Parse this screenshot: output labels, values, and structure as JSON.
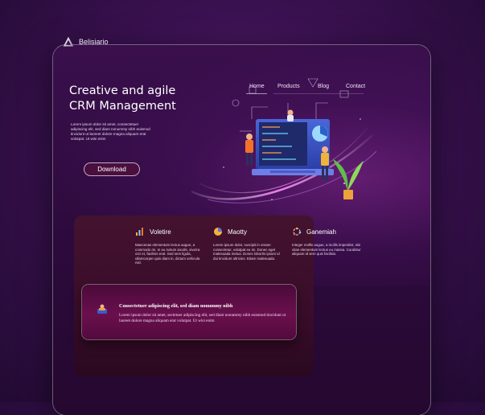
{
  "brand": {
    "name": "Belisiario"
  },
  "nav": [
    {
      "label": "Home",
      "active": true
    },
    {
      "label": "Products",
      "active": false
    },
    {
      "label": "Blog",
      "active": false
    },
    {
      "label": "Contact",
      "active": false
    }
  ],
  "hero": {
    "title_line1": "Creative and agile",
    "title_line2": "CRM Management",
    "body": "Lorem ipsum dolor sit amet, consectetuer adipiscing elit, sed diam nonummy nibh euismod tincidunt ut laoreet dolore magna aliquam erat volutpat. Ut wisi enim",
    "cta_label": "Download"
  },
  "features": [
    {
      "title": "Voletire",
      "icon": "bar-chart-icon",
      "text": "Maecenas elementum lectus augue, a commodo mi. In eu rutrum iaculis, viverra orci et, facilisis erat. Sed sem ligula, ullamcorper quis diam in, dictum vehicula nisl."
    },
    {
      "title": "Maotty",
      "icon": "pie-chart-icon",
      "text": "Lorem ipsum dolor, suscipit in ornare consectetur, volutpat eu mi. Donec eget malesuada metus. Donec lobortis ipsum id dui tincidunt ultricies. Etiam malesuada."
    },
    {
      "title": "Ganemiah",
      "icon": "cycle-icon",
      "text": "Integer mollis augue, a mollis imperdiet, nisi vitae elementum lectus eu massa. Curabitur aliquam id sem quis facilisis."
    }
  ],
  "callout": {
    "icon": "presentation-icon",
    "title": "Consectetuer adipiscing elit, sed diam nonummy nibh",
    "text": "Lorem ipsum dolor sit amet, sectetuer adipiscing elit, sed diam nonummy nibh euismod tincidunt ut laoreet dolore magna aliquam erat volutpat. Ut wisi enim"
  },
  "colors": {
    "accent": "#c03fd0",
    "background": "#3a1150",
    "button": "#4a0f3f",
    "card": "#6a0f4d"
  }
}
